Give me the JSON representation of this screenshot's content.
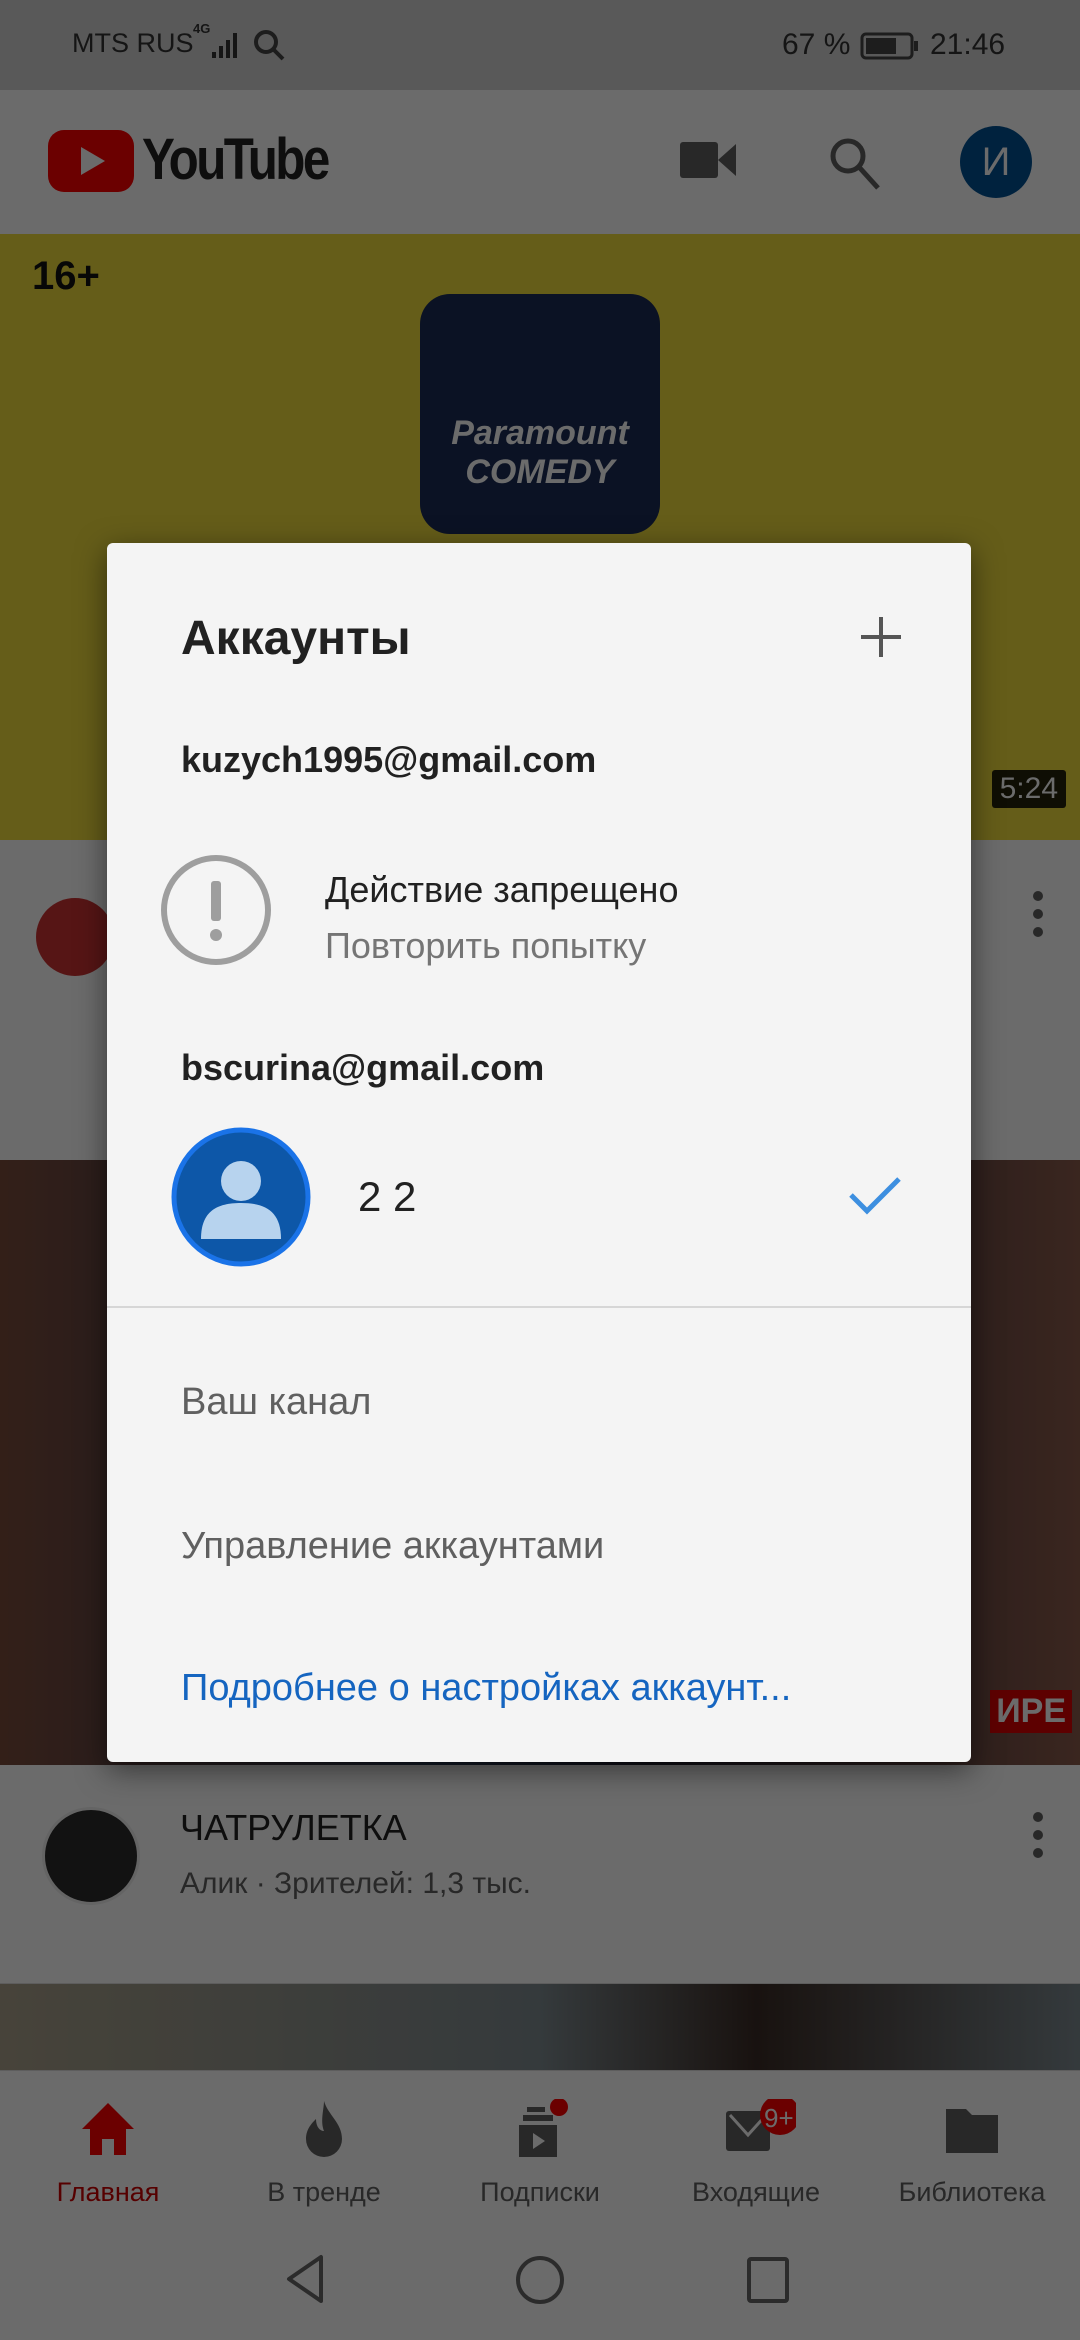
{
  "status_bar": {
    "carrier": "MTS RUS",
    "network": "4G",
    "battery": "67 %",
    "time": "21:46"
  },
  "header": {
    "logo_text": "YouTube",
    "avatar_letter": "И"
  },
  "feed": {
    "video1": {
      "age_badge": "16+",
      "duration": "5:24",
      "channel_logo": "Paramount COMEDY"
    },
    "video2": {
      "badge": "ИРЕ",
      "title": "ЧАТРУЛЕТКА",
      "subtitle": "Алик · Зрителей: 1,3 тыс."
    }
  },
  "dialog": {
    "title": "Аккаунты",
    "accounts": [
      {
        "email": "kuzych1995@gmail.com",
        "error_title": "Действие запрещено",
        "error_action": "Повторить попытку"
      },
      {
        "email": "bscurina@gmail.com",
        "name": "2 2",
        "selected": true
      }
    ],
    "menu": {
      "your_channel": "Ваш канал",
      "manage_accounts": "Управление аккаунтами",
      "account_settings_link": "Подробнее о настройках аккаунт..."
    }
  },
  "bottom_nav": [
    {
      "label": "Главная",
      "icon": "home-icon",
      "active": true
    },
    {
      "label": "В тренде",
      "icon": "flame-icon"
    },
    {
      "label": "Подписки",
      "icon": "subscriptions-icon",
      "dot": true
    },
    {
      "label": "Входящие",
      "icon": "inbox-icon",
      "badge": "9+"
    },
    {
      "label": "Библиотека",
      "icon": "folder-icon"
    }
  ],
  "colors": {
    "accent": "#ff0000",
    "link": "#1565c0",
    "check": "#3d8fe0",
    "avatar": "#0d57a8"
  }
}
